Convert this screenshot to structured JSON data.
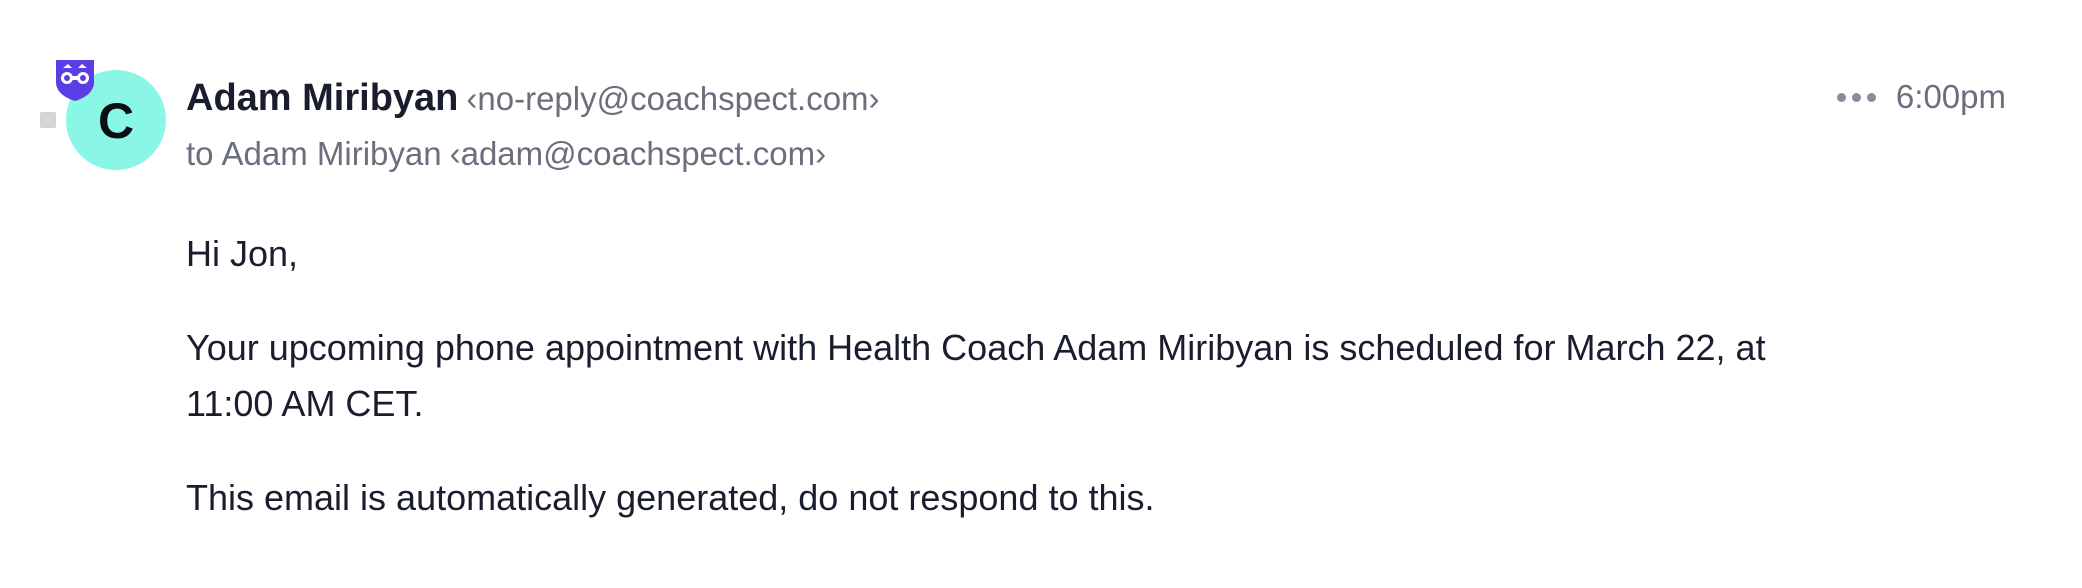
{
  "email": {
    "avatar_letter": "C",
    "avatar_color": "#8af7e6",
    "badge_icon": "shield-binoculars-icon",
    "badge_color": "#5b3ee6",
    "sender_name": "Adam Miribyan",
    "sender_email": "‹no-reply@coachspect.com›",
    "to_prefix": "to",
    "recipient_name": "Adam Miribyan",
    "recipient_email": "‹adam@coachspect.com›",
    "more_icon": "more-horizontal-icon",
    "timestamp": "6:00pm",
    "body": {
      "greeting": "Hi Jon,",
      "paragraph_1": "Your upcoming phone appointment with Health Coach Adam Miribyan is scheduled for March 22, at 11:00 AM CET.",
      "paragraph_2": "This email is automatically generated, do not respond to this."
    }
  }
}
